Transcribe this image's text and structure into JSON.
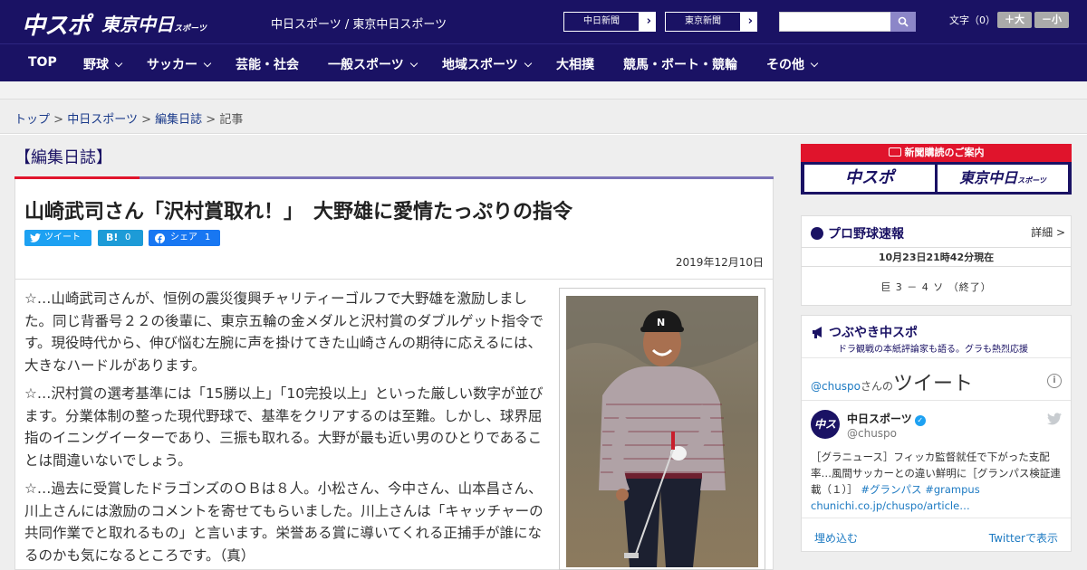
{
  "header": {
    "logo_chuspo": "中スポ",
    "logo_tokyo": "東京中日",
    "logo_tokyo_sub": "スポーツ",
    "site_name": "中日スポーツ / 東京中日スポーツ",
    "ext_links": [
      {
        "label": "中日新聞",
        "arrow": "›"
      },
      {
        "label": "東京新聞",
        "arrow": "›"
      }
    ],
    "search_placeholder": "",
    "font_size_label": "文字（0）",
    "font_bigger": "＋大",
    "font_smaller": "－小"
  },
  "nav": {
    "items": [
      {
        "label": "TOP",
        "has_dropdown": false
      },
      {
        "label": "野球",
        "has_dropdown": true
      },
      {
        "label": "サッカー",
        "has_dropdown": true
      },
      {
        "label": "芸能・社会",
        "has_dropdown": false
      },
      {
        "label": "一般スポーツ",
        "has_dropdown": true
      },
      {
        "label": "地域スポーツ",
        "has_dropdown": true
      },
      {
        "label": "大相撲",
        "has_dropdown": false
      },
      {
        "label": "競馬・ボート・競輪",
        "has_dropdown": false
      },
      {
        "label": "その他",
        "has_dropdown": true
      }
    ]
  },
  "breadcrumb": {
    "items": [
      "トップ",
      "中日スポーツ",
      "編集日誌"
    ],
    "separator": ">",
    "current": "記事"
  },
  "article": {
    "section": "【編集日誌】",
    "headline": "山崎武司さん「沢村賞取れ！」　大野雄に愛情たっぷりの指令",
    "share": {
      "tweet": "ツイート",
      "hatena_icon": "B!",
      "hatena_count": "0",
      "fb_label": "シェア",
      "fb_count": "1"
    },
    "date": "2019年12月10日",
    "paragraphs": [
      "☆…山崎武司さんが、恒例の震災復興チャリティーゴルフで大野雄を激励しました。同じ背番号２２の後輩に、東京五輪の金メダルと沢村賞のダブルゲット指令です。現役時代から、伸び悩む左腕に声を掛けてきた山崎さんの期待に応えるには、大きなハードルがあります。",
      "☆…沢村賞の選考基準には「15勝以上」「10完投以上」といった厳しい数字が並びます。分業体制の整った現代野球で、基準をクリアするのは至難。しかし、球界屈指のイニングイーターであり、三振も取れる。大野が最も近い男のひとりであることは間違いないでしょう。",
      "☆…過去に受賞したドラゴンズのＯＢは８人。小松さん、今中さん、山本昌さん、川上さんには激励のコメントを寄せてもらいました。川上さんは「キャッチャーの共同作業でと取れるもの」と言います。栄誉ある賞に導いてくれる正捕手が誰になるのかも気になるところです。（真）"
    ]
  },
  "sidebar": {
    "ad": {
      "title": "新聞購読のご案内",
      "left": "中スポ",
      "right": "東京中日",
      "right_sub": "スポーツ"
    },
    "baseball": {
      "title": "プロ野球速報",
      "detail": "詳細 >",
      "timestamp": "10月23日21時42分現在",
      "score_line": "巨 3 － 4 ソ （終了）"
    },
    "tweets": {
      "title": "つぶやき中スポ",
      "subtitle": "ドラ観戦の本紙評論家も語る。グラも熱烈応援",
      "header_handle": "@chuspo",
      "header_san": "さんの",
      "header_big": "ツイート",
      "info": "i",
      "avatar": "中スポ",
      "name": "中日スポーツ",
      "verified": "✓",
      "handle": "@chuspo",
      "text": "［グラニュース］フィッカ監督就任で下がった支配率…風間サッカーとの違い鮮明に［グランパス検証連載（１）］",
      "hashtags": "#グランパス #grampus",
      "link": "chunichi.co.jp/chuspo/article…",
      "embed": "埋め込む",
      "view": "Twitterで表示"
    }
  },
  "colors": {
    "brand_navy": "#1a1264",
    "accent_red": "#e0142c",
    "link_blue": "#1d7ac2",
    "twitter_blue": "#1da1f2"
  }
}
